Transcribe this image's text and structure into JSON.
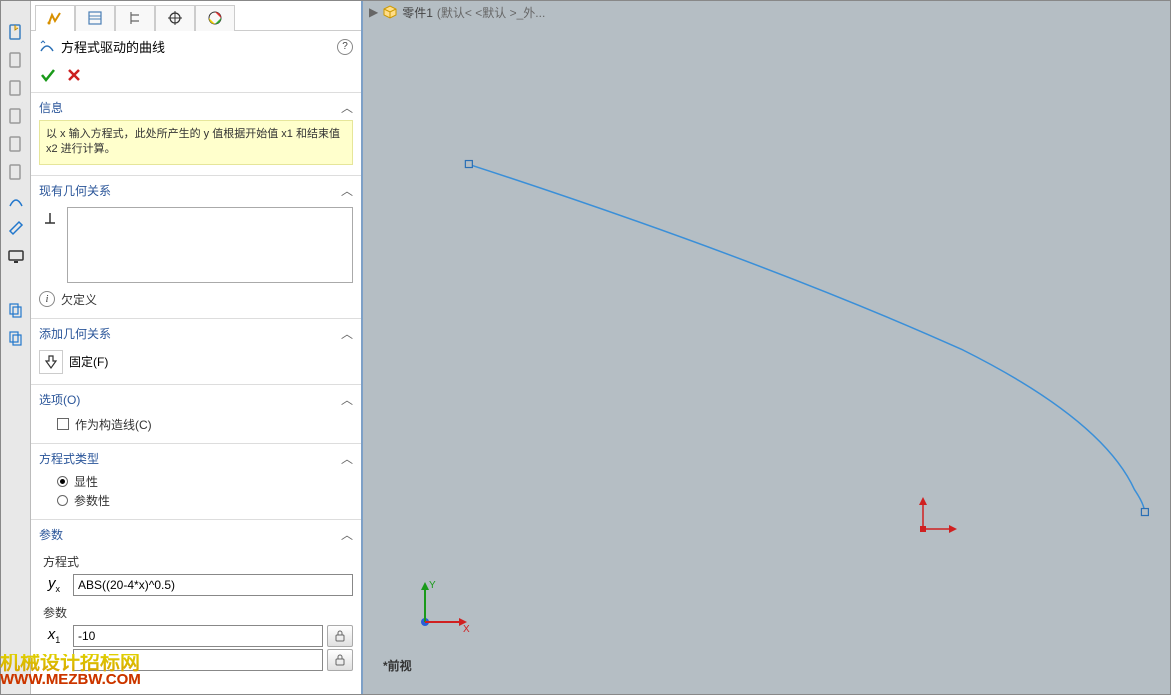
{
  "breadcrumb": {
    "part": "零件1",
    "config": "(默认< <默认 >_外..."
  },
  "feature": {
    "title": "方程式驱动的曲线"
  },
  "sections": {
    "info": {
      "title": "信息",
      "text": "以 x 输入方程式，此处所产生的 y 值根据开始值 x1 和结束值 x2 进行计算。"
    },
    "existing_relations": {
      "title": "现有几何关系",
      "underdef": "欠定义"
    },
    "add_relations": {
      "title": "添加几何关系",
      "fix_label": "固定(F)"
    },
    "options": {
      "title": "选项(O)",
      "construction": "作为构造线(C)"
    },
    "equation_type": {
      "title": "方程式类型",
      "explicit": "显性",
      "parametric": "参数性"
    },
    "params": {
      "title": "参数",
      "equation_label": "方程式",
      "yx_label": "yₓ",
      "yx_value": "ABS((20-4*x)^0.5)",
      "param_label": "参数",
      "x1_label": "x₁",
      "x1_value": "-10",
      "x2_value": ""
    }
  },
  "viewport": {
    "view_label": "*前视",
    "axes": {
      "x": "X",
      "y": "Y"
    }
  },
  "icons": {
    "check": "✓",
    "cross": "✕",
    "help": "?",
    "info": "i",
    "triangle": "▶"
  },
  "watermark": {
    "zh": "机械设计招标网",
    "url": "WWW.MEZBW.COM"
  }
}
